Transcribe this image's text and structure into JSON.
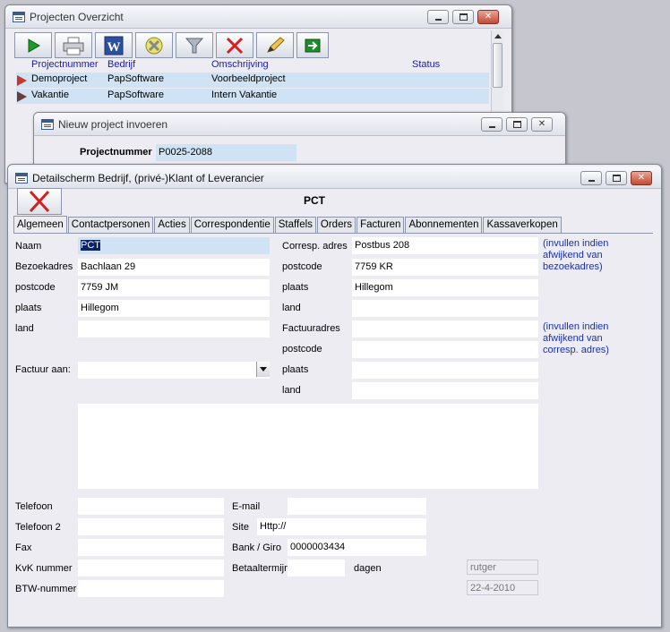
{
  "colors": {
    "highlight_row": "#cfe3f5",
    "header_text": "#1a1aa8",
    "note_text": "#1a2fb0",
    "close_red": "#c24a33"
  },
  "window_overview": {
    "title": "Projecten Overzicht",
    "toolbar": [
      {
        "icon": "play-icon"
      },
      {
        "icon": "printer-icon"
      },
      {
        "icon": "word-icon"
      },
      {
        "icon": "filter-clear-icon"
      },
      {
        "icon": "filter-icon"
      },
      {
        "icon": "delete-x-icon"
      },
      {
        "icon": "edit-pencil-icon"
      },
      {
        "icon": "exit-arrow-icon"
      }
    ],
    "columns": [
      "Projectnummer",
      "Bedrijf",
      "Omschrijving",
      "Status"
    ],
    "rows": [
      {
        "projectnummer": "Demoproject",
        "bedrijf": "PapSoftware",
        "omschrijving": "Voorbeeldproject",
        "status": ""
      },
      {
        "projectnummer": "Vakantie",
        "bedrijf": "PapSoftware",
        "omschrijving": "Intern Vakantie",
        "status": ""
      }
    ]
  },
  "window_new": {
    "title": "Nieuw project invoeren",
    "projectnummer_label": "Projectnummer",
    "projectnummer_value": "P0025-2088"
  },
  "window_detail": {
    "title": "Detailscherm Bedrijf, (privé-)Klant of Leverancier",
    "heading": "PCT",
    "tabs": [
      "Algemeen",
      "Contactpersonen",
      "Acties",
      "Correspondentie",
      "Staffels",
      "Orders",
      "Facturen",
      "Abonnementen",
      "Kassaverkopen"
    ],
    "active_tab": "Algemeen",
    "fields": {
      "naam": {
        "label": "Naam",
        "value": "PCT"
      },
      "bezoekadres": {
        "label": "Bezoekadres",
        "value": "Bachlaan 29"
      },
      "postcode": {
        "label": "postcode",
        "value": "7759 JM"
      },
      "plaats": {
        "label": "plaats",
        "value": "Hillegom"
      },
      "land": {
        "label": "land",
        "value": ""
      },
      "factuur_aan": {
        "label": "Factuur aan:",
        "value": ""
      },
      "corresp_adres": {
        "label": "Corresp. adres",
        "value": "Postbus 208"
      },
      "corresp_postcode": {
        "label": "postcode",
        "value": "7759 KR"
      },
      "corresp_plaats": {
        "label": "plaats",
        "value": "Hillegom"
      },
      "corresp_land": {
        "label": "land",
        "value": ""
      },
      "factuuradres": {
        "label": "Factuuradres",
        "value": ""
      },
      "factuur_postcode": {
        "label": "postcode",
        "value": ""
      },
      "factuur_plaats": {
        "label": "plaats",
        "value": ""
      },
      "factuur_land": {
        "label": "land",
        "value": ""
      },
      "telefoon": {
        "label": "Telefoon",
        "value": ""
      },
      "telefoon2": {
        "label": "Telefoon 2",
        "value": ""
      },
      "fax": {
        "label": "Fax",
        "value": ""
      },
      "kvk": {
        "label": "KvK nummer",
        "value": ""
      },
      "btw": {
        "label": "BTW-nummer",
        "value": ""
      },
      "email": {
        "label": "E-mail",
        "value": ""
      },
      "site": {
        "label": "Site",
        "value": "Http://"
      },
      "bank": {
        "label": "Bank / Giro",
        "value": "0000003434"
      },
      "betaaltermijn": {
        "label": "Betaaltermijn",
        "value": ""
      },
      "dagen_label": "dagen",
      "user": "rutger",
      "date": "22-4-2010"
    },
    "notes": {
      "corresp": [
        "(invullen indien",
        "afwijkend van",
        "bezoekadres)"
      ],
      "factuur": [
        "(invullen indien",
        "afwijkend van",
        "corresp. adres)"
      ]
    }
  }
}
